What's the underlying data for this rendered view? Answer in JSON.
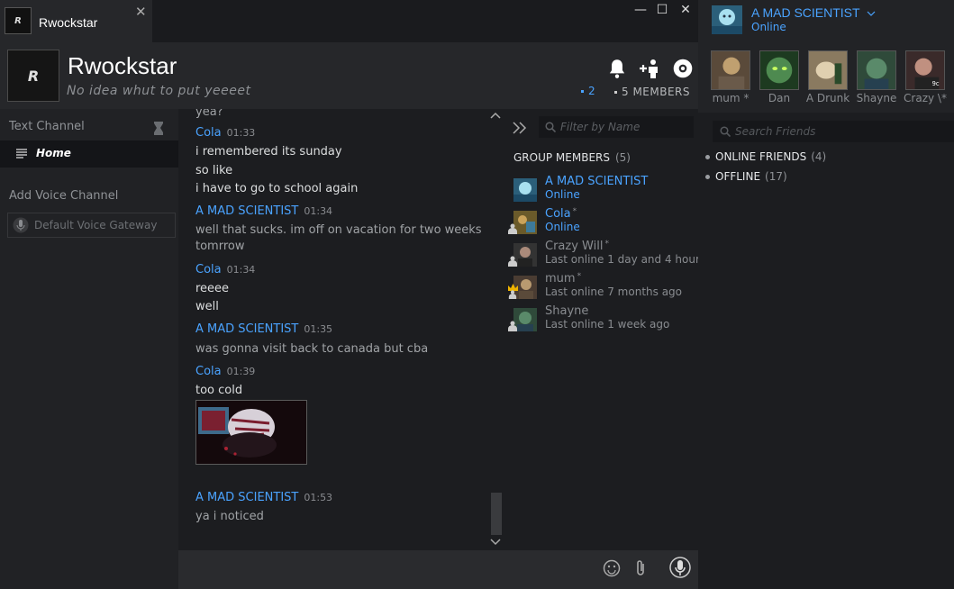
{
  "tab": {
    "title": "Rwockstar",
    "avatar_text": "R",
    "close": "✕"
  },
  "window_controls": {
    "minimize": "—",
    "maximize": "☐",
    "close": "✕"
  },
  "group": {
    "name": "Rwockstar",
    "avatar_text": "R",
    "tagline": "No idea whut to put yeeeet",
    "voice_count": "2",
    "member_count": "5 MEMBERS"
  },
  "channels": {
    "text_header": "Text Channel",
    "home": "Home",
    "add_voice": "Add Voice Channel",
    "voice_gateway": "Default Voice Gateway"
  },
  "messages": [
    {
      "author": "",
      "time": "",
      "lines": [
        "yea?"
      ]
    },
    {
      "author": "Cola",
      "time": "01:33",
      "lines": [
        "i remembered its sunday",
        "so like",
        "i have to go to school again"
      ]
    },
    {
      "author": "A MAD SCIENTIST",
      "time": "01:34",
      "lines": [
        "well that sucks. im off on vacation for two weeks",
        "tomrrow"
      ]
    },
    {
      "author": "Cola",
      "time": "01:34",
      "lines": [
        "reeee",
        "well"
      ]
    },
    {
      "author": "A MAD SCIENTIST",
      "time": "01:35",
      "lines": [
        "was gonna visit back to canada but cba"
      ]
    },
    {
      "author": "Cola",
      "time": "01:39",
      "lines": [
        "too cold"
      ]
    },
    {
      "author": "A MAD SCIENTIST",
      "time": "01:53",
      "lines": [
        "ya i noticed"
      ]
    }
  ],
  "members_panel": {
    "filter_placeholder": "Filter by Name",
    "header": "GROUP MEMBERS",
    "count": "(5)",
    "members": [
      {
        "name": "A MAD SCIENTIST",
        "status": "Online",
        "star": "",
        "online": true
      },
      {
        "name": "Cola",
        "status": "Online",
        "star": "*",
        "online": true
      },
      {
        "name": "Crazy Will",
        "status": "Last online 1 day and 4 hour",
        "star": "*",
        "online": false
      },
      {
        "name": "mum",
        "status": "Last online 7 months ago",
        "star": "*",
        "online": false
      },
      {
        "name": "Shayne",
        "status": "Last online 1 week ago",
        "star": "",
        "online": false
      }
    ]
  },
  "friends": {
    "me_name": "A MAD SCIENTIST",
    "me_status": "Online",
    "favorites": [
      "mum *",
      "Dan",
      "A Drunk",
      "Shayne",
      "Crazy \\*"
    ],
    "search_placeholder": "Search Friends",
    "online_label": "ONLINE FRIENDS",
    "online_count": "(4)",
    "offline_label": "OFFLINE",
    "offline_count": "(17)"
  },
  "colors": {
    "accent": "#4aa3ff",
    "background": "#1c1d20",
    "panel": "#26272a"
  }
}
